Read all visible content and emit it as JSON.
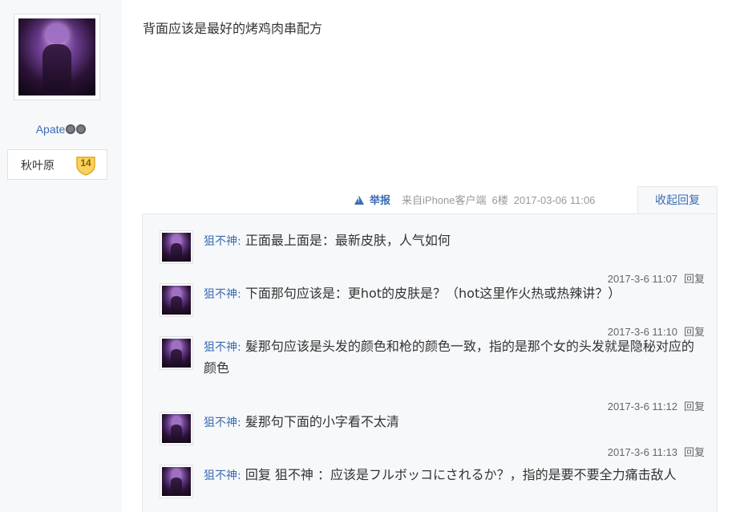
{
  "author": {
    "username": "Apate",
    "level_name": "秋叶原",
    "level": "14"
  },
  "post": {
    "content": "背面应该是最好的烤鸡肉串配方",
    "report_label": "举报",
    "client": "来自iPhone客户端",
    "floor": "6楼",
    "time": "2017-03-06 11:06",
    "collapse_label": "收起回复"
  },
  "replies": [
    {
      "name": "狙不神:",
      "text": "正面最上面是：最新皮肤，人气如何",
      "time": "2017-3-6 11:07",
      "reply_label": "回复"
    },
    {
      "name": "狙不神:",
      "text": "下面那句应该是：更hot的皮肤是？（hot这里作火热或热辣讲？）",
      "time": "2017-3-6 11:10",
      "reply_label": "回复"
    },
    {
      "name": "狙不神:",
      "text": "髮那句应该是头发的颜色和枪的颜色一致，指的是那个女的头发就是隐秘对应的颜色",
      "time": "2017-3-6 11:12",
      "reply_label": "回复"
    },
    {
      "name": "狙不神:",
      "text": "髮那句下面的小字看不太清",
      "time": "2017-3-6 11:13",
      "reply_label": "回复"
    },
    {
      "name": "狙不神:",
      "text": "回复 狙不神 ：应该是フルボッコにされるか？，指的是要不要全力痛击敌人",
      "time": "",
      "reply_label": ""
    }
  ]
}
